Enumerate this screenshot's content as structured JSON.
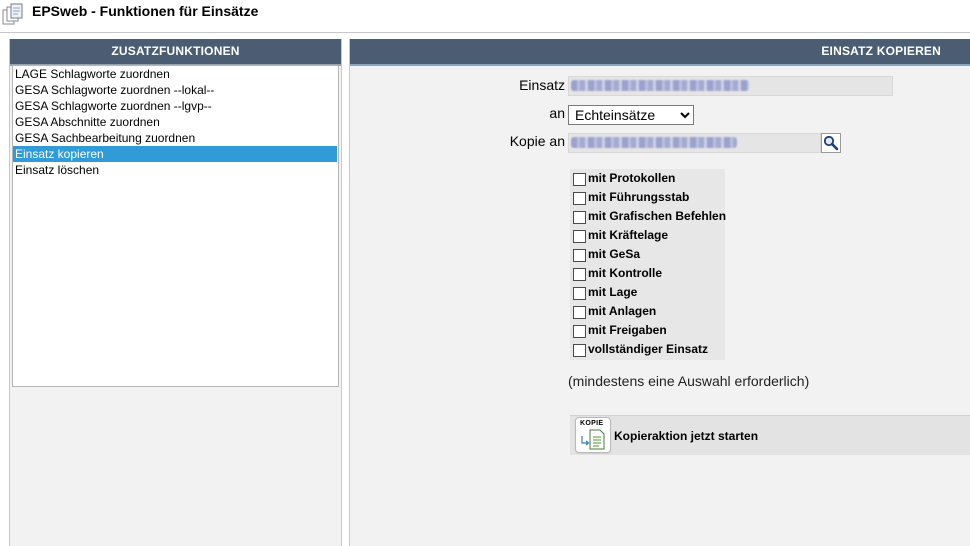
{
  "window": {
    "title": "EPSweb - Funktionen für Einsätze",
    "app_icon": "documents-icon"
  },
  "left_panel": {
    "header": "ZUSATZFUNKTIONEN",
    "items": [
      {
        "label": "LAGE Schlagworte zuordnen",
        "selected": false
      },
      {
        "label": "GESA Schlagworte zuordnen --lokal--",
        "selected": false
      },
      {
        "label": "GESA Schlagworte zuordnen --lgvp--",
        "selected": false
      },
      {
        "label": "GESA Abschnitte zuordnen",
        "selected": false
      },
      {
        "label": "GESA Sachbearbeitung zuordnen",
        "selected": false
      },
      {
        "label": "Einsatz kopieren",
        "selected": true
      },
      {
        "label": "Einsatz löschen",
        "selected": false
      }
    ]
  },
  "right_panel": {
    "header": "EINSATZ KOPIEREN",
    "einsatz_label": "Einsatz",
    "an_label": "an",
    "an_selected": "Echteinsätze",
    "kopie_an_label": "Kopie an",
    "search_icon": "magnifier-icon",
    "options": [
      {
        "label": "mit Protokollen",
        "checked": false
      },
      {
        "label": "mit Führungsstab",
        "checked": false
      },
      {
        "label": "mit Grafischen Befehlen",
        "checked": false
      },
      {
        "label": "mit Kräftelage",
        "checked": false
      },
      {
        "label": "mit GeSa",
        "checked": false
      },
      {
        "label": "mit Kontrolle",
        "checked": false
      },
      {
        "label": "mit Lage",
        "checked": false
      },
      {
        "label": "mit Anlagen",
        "checked": false
      },
      {
        "label": "mit Freigaben",
        "checked": false
      },
      {
        "label": "vollständiger Einsatz",
        "checked": false
      }
    ],
    "hint": "(mindestens eine Auswahl erforderlich)",
    "action": {
      "icon_text": "KOPIE",
      "icon": "copy-document-icon",
      "label": "Kopieraktion jetzt starten"
    }
  },
  "colors": {
    "header_bg": "#4a5d73",
    "selection": "#2f9bd7",
    "panel_bg": "#f2f2f2"
  }
}
